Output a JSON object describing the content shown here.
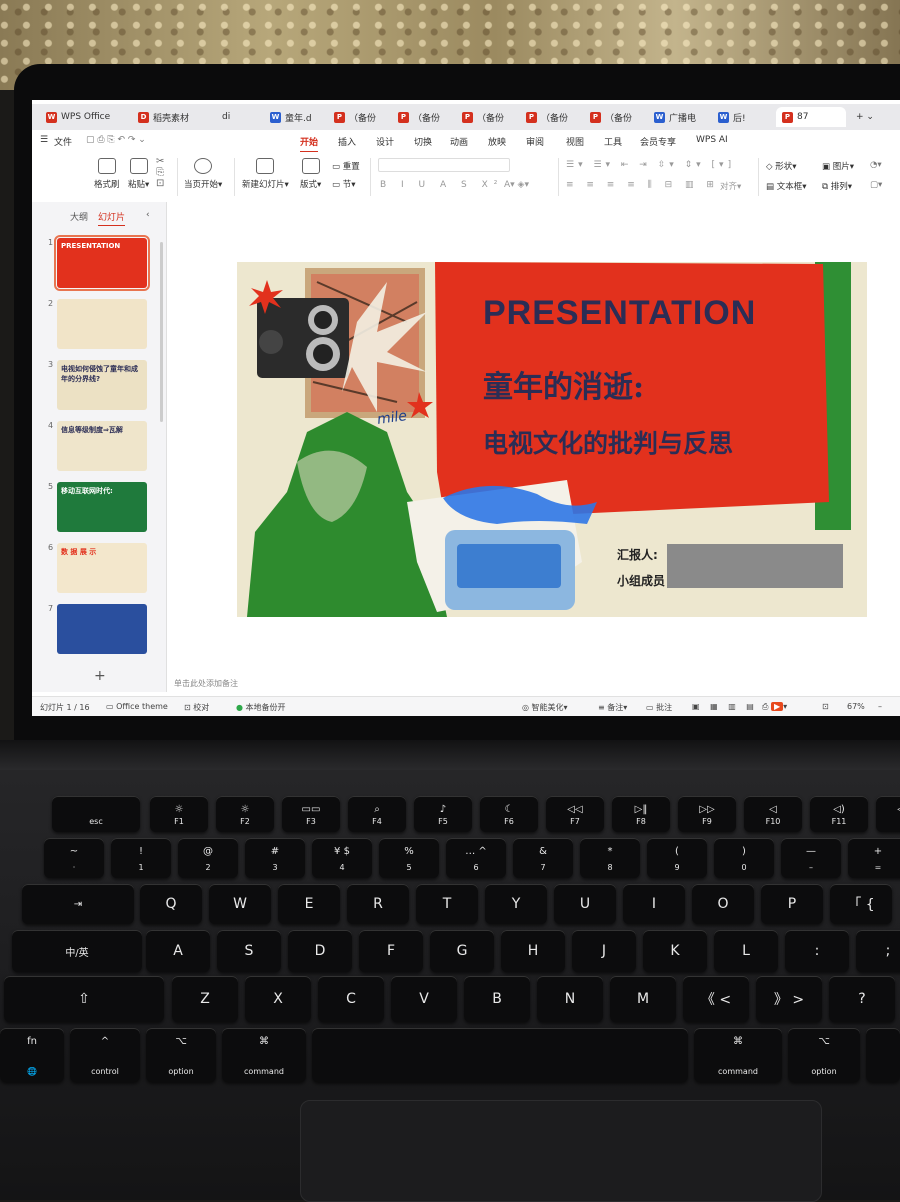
{
  "tabs": [
    {
      "label": "WPS Office",
      "logo": "W",
      "color": "#d4301e"
    },
    {
      "label": "稻壳素材",
      "logo": "D",
      "color": "#d4301e"
    },
    {
      "label": "di",
      "logo": "",
      "color": "#888"
    },
    {
      "label": "童年.d",
      "logo": "W",
      "color": "#2b5fcf"
    },
    {
      "label": "（备份",
      "logo": "P",
      "color": "#d4301e"
    },
    {
      "label": "（备份",
      "logo": "P",
      "color": "#d4301e"
    },
    {
      "label": "（备份",
      "logo": "P",
      "color": "#d4301e"
    },
    {
      "label": "（备份",
      "logo": "P",
      "color": "#d4301e"
    },
    {
      "label": "（备份",
      "logo": "P",
      "color": "#d4301e"
    },
    {
      "label": "广播电",
      "logo": "W",
      "color": "#2b5fcf"
    },
    {
      "label": "后!",
      "logo": "W",
      "color": "#2b5fcf"
    },
    {
      "label": "87",
      "logo": "P",
      "color": "#d4301e"
    }
  ],
  "menu": {
    "file": "文件",
    "items": [
      "开始",
      "插入",
      "设计",
      "切换",
      "动画",
      "放映",
      "审阅",
      "视图",
      "工具",
      "会员专享",
      "WPS AI"
    ],
    "active": "开始"
  },
  "ribbon": {
    "format_painter": "格式刷",
    "paste": "粘贴",
    "play_from_current": "当页开始",
    "new_slide": "新建幻灯片",
    "layout": "版式",
    "reset": "重置",
    "section": "节",
    "align": "对齐",
    "shape": "形状",
    "picture": "图片",
    "textbox": "文本框",
    "arrange": "排列"
  },
  "sidebar": {
    "tab_outline": "大纲",
    "tab_slides": "幻灯片",
    "thumbnails": [
      {
        "num": "1",
        "title": "PRESENTATION"
      },
      {
        "num": "2",
        "title": ""
      },
      {
        "num": "3",
        "title": "电视如何侵蚀了童年和成年的分界线?"
      },
      {
        "num": "4",
        "title": "信息等级制度⇒瓦解"
      },
      {
        "num": "5",
        "title": "移动互联网时代:"
      },
      {
        "num": "6",
        "title": "数 据 展 示"
      },
      {
        "num": "7",
        "title": ""
      }
    ],
    "add": "+"
  },
  "slide": {
    "title_en": "PRESENTATION",
    "title_cn": "童年的消逝:",
    "subtitle_cn": "电视文化的批判与反思",
    "reporter_label": "汇报人:",
    "members_label": "小组成员",
    "smile_text": "mile"
  },
  "note_placeholder": "单击此处添加备注",
  "status": {
    "slide_counter": "幻灯片 1 / 16",
    "theme": "Office theme",
    "proof": "校对",
    "backup": "本地备份开",
    "beautify": "智能美化",
    "notes": "备注",
    "comments": "批注",
    "zoom": "67%"
  },
  "keyboard": {
    "fn_row": [
      {
        "sub": "esc",
        "top": ""
      },
      {
        "sub": "F1",
        "top": "☼"
      },
      {
        "sub": "F2",
        "top": "☼"
      },
      {
        "sub": "F3",
        "top": "▭▭"
      },
      {
        "sub": "F4",
        "top": "⌕"
      },
      {
        "sub": "F5",
        "top": "♪"
      },
      {
        "sub": "F6",
        "top": "☾"
      },
      {
        "sub": "F7",
        "top": "◁◁"
      },
      {
        "sub": "F8",
        "top": "▷‖"
      },
      {
        "sub": "F9",
        "top": "▷▷"
      },
      {
        "sub": "F10",
        "top": "◁"
      },
      {
        "sub": "F11",
        "top": "◁)"
      },
      {
        "sub": "",
        "top": "◁))"
      }
    ],
    "num_row": [
      {
        "top": "~",
        "sub": "·"
      },
      {
        "top": "!",
        "sub": "1"
      },
      {
        "top": "@",
        "sub": "2"
      },
      {
        "top": "#",
        "sub": "3"
      },
      {
        "top": "¥   $",
        "sub": "4"
      },
      {
        "top": "%",
        "sub": "5"
      },
      {
        "top": "…  ^",
        "sub": "6"
      },
      {
        "top": "&",
        "sub": "7"
      },
      {
        "top": "*",
        "sub": "8"
      },
      {
        "top": "(",
        "sub": "9"
      },
      {
        "top": ")",
        "sub": "0"
      },
      {
        "top": "—",
        "sub": "–"
      },
      {
        "top": "+",
        "sub": "="
      }
    ],
    "row_q": [
      "Q",
      "W",
      "E",
      "R",
      "T",
      "Y",
      "U",
      "I",
      "O",
      "P",
      "「  {"
    ],
    "row_a": [
      "A",
      "S",
      "D",
      "F",
      "G",
      "H",
      "J",
      "K",
      "L",
      ":",
      ";"
    ],
    "row_z": [
      "Z",
      "X",
      "C",
      "V",
      "B",
      "N",
      "M",
      "《  <",
      "》  >",
      "?"
    ],
    "tab_key": "⇥",
    "caps_key": "中/英",
    "shift_key": "⇧",
    "fn_key": "fn",
    "globe_key": "🌐",
    "control_key": "control",
    "control_sym": "^",
    "option_key": "option",
    "option_sym": "⌥",
    "command_key": "command",
    "command_sym": "⌘"
  }
}
